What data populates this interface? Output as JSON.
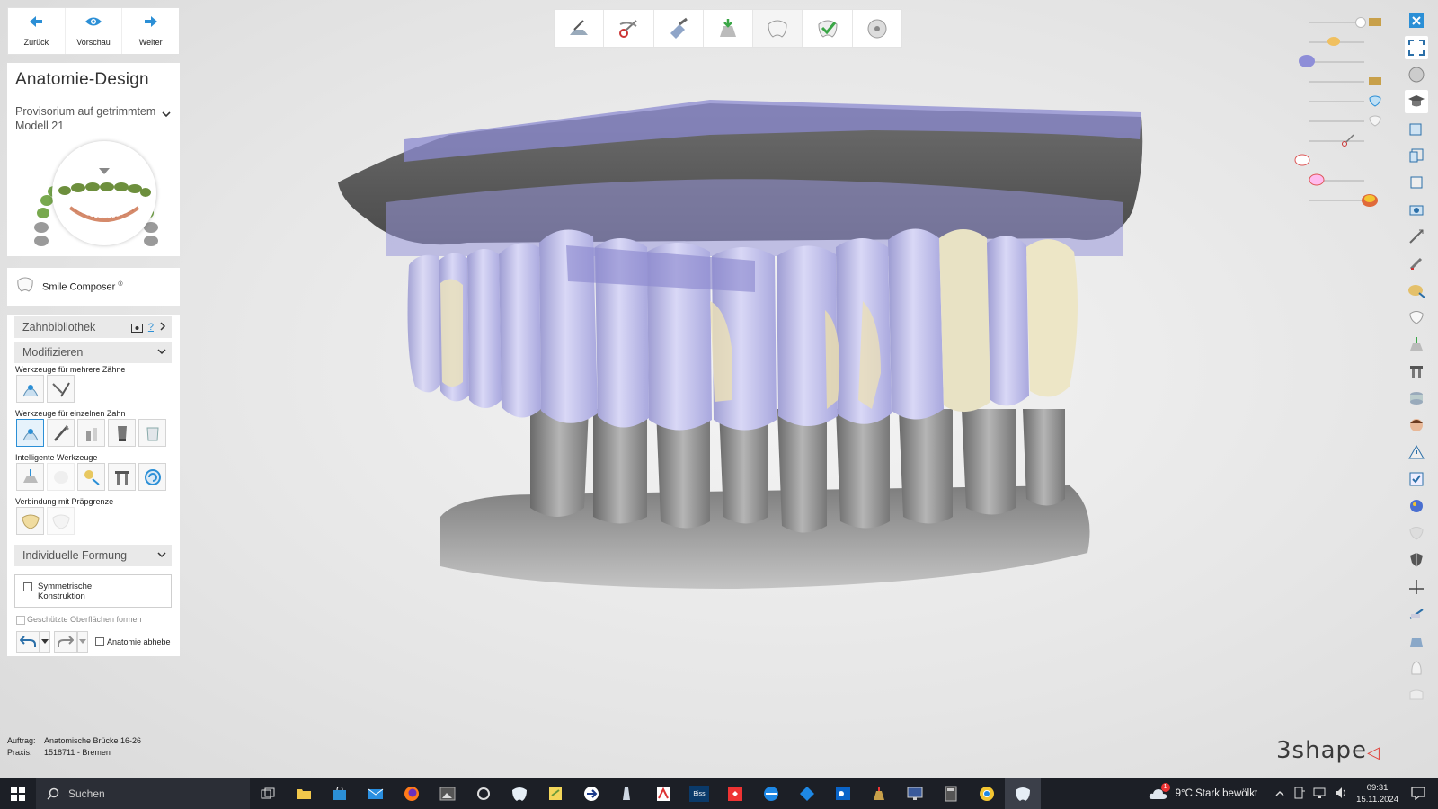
{
  "navigation": {
    "back_label": "Zurück",
    "preview_label": "Vorschau",
    "next_label": "Weiter"
  },
  "panel": {
    "title": "Anatomie-Design",
    "subtitle": "Provisorium auf getrimmtem Modell 21",
    "smile_composer_label": "Smile Composer",
    "smile_composer_mark": "®"
  },
  "library": {
    "label": "Zahnbibliothek",
    "help_label": "?"
  },
  "modify": {
    "label": "Modifizieren",
    "multi_tools_label": "Werkzeuge für mehrere Zähne",
    "single_tools_label": "Werkzeuge für einzelnen Zahn",
    "smart_tools_label": "Intelligente Werkzeuge",
    "prep_connection_label": "Verbindung mit Präpgrenze"
  },
  "individual": {
    "label": "Individuelle Formung",
    "symmetric_label_line1": "Symmetrische",
    "symmetric_label_line2": "Konstruktion",
    "symmetric_checked": false,
    "protected_label": "Geschützte Oberflächen formen",
    "protected_checked": false
  },
  "footer_controls": {
    "anatomy_label": "Anatomie abhebe",
    "anatomy_checked": false
  },
  "info": {
    "order_key": "Auftrag:",
    "order_value": "Anatomische Brücke 16-26",
    "practice_key": "Praxis:",
    "practice_value": "1518711 - Bremen"
  },
  "brand": {
    "name": "3shape"
  },
  "workflow_steps": [
    "scan-step-icon",
    "trim-step-icon",
    "prep-step-icon",
    "insertion-step-icon",
    "anatomy-step-icon",
    "check-step-icon",
    "finish-step-icon"
  ],
  "colors": {
    "accent": "#2b8fd6",
    "restoration": "#b9b8e6",
    "model": "#8e8e8e",
    "brand_mark": "#e0413a",
    "taskbar": "#1c1f26"
  },
  "taskbar": {
    "search_placeholder": "Suchen",
    "weather": "9°C  Stark bewölkt",
    "weather_badge": "1",
    "time": "09:31",
    "date": "15.11.2024"
  }
}
